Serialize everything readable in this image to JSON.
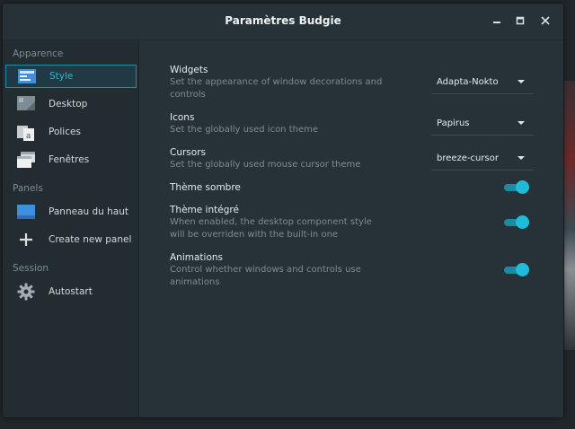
{
  "window": {
    "title": "Paramètres Budgie"
  },
  "sidebar": {
    "sections": [
      {
        "label": "Apparence"
      },
      {
        "label": "Panels"
      },
      {
        "label": "Session"
      }
    ],
    "items": [
      {
        "label": "Style",
        "icon": "style-icon"
      },
      {
        "label": "Desktop",
        "icon": "desktop-icon"
      },
      {
        "label": "Polices",
        "icon": "fonts-icon"
      },
      {
        "label": "Fenêtres",
        "icon": "windows-icon"
      },
      {
        "label": "Panneau du haut",
        "icon": "panel-icon"
      },
      {
        "label": "Create new panel",
        "icon": "plus-icon"
      },
      {
        "label": "Autostart",
        "icon": "gear-icon"
      }
    ]
  },
  "settings": {
    "widgets": {
      "title": "Widgets",
      "description": "Set the appearance of window decorations and controls",
      "value": "Adapta-Nokto"
    },
    "icons": {
      "title": "Icons",
      "description": "Set the globally used icon theme",
      "value": "Papirus"
    },
    "cursors": {
      "title": "Cursors",
      "description": "Set the globally used mouse cursor theme",
      "value": "breeze-cursor"
    },
    "dark_theme": {
      "title": "Thème sombre",
      "enabled": true
    },
    "integrated_theme": {
      "title": "Thème intégré",
      "description": "When enabled, the desktop component style will be overriden with the built-in one",
      "enabled": true
    },
    "animations": {
      "title": "Animations",
      "description": "Control whether windows and controls use animations",
      "enabled": true
    }
  },
  "colors": {
    "accent": "#1ebcd9",
    "window_bg": "#263238",
    "sidebar_bg": "#222c31"
  }
}
